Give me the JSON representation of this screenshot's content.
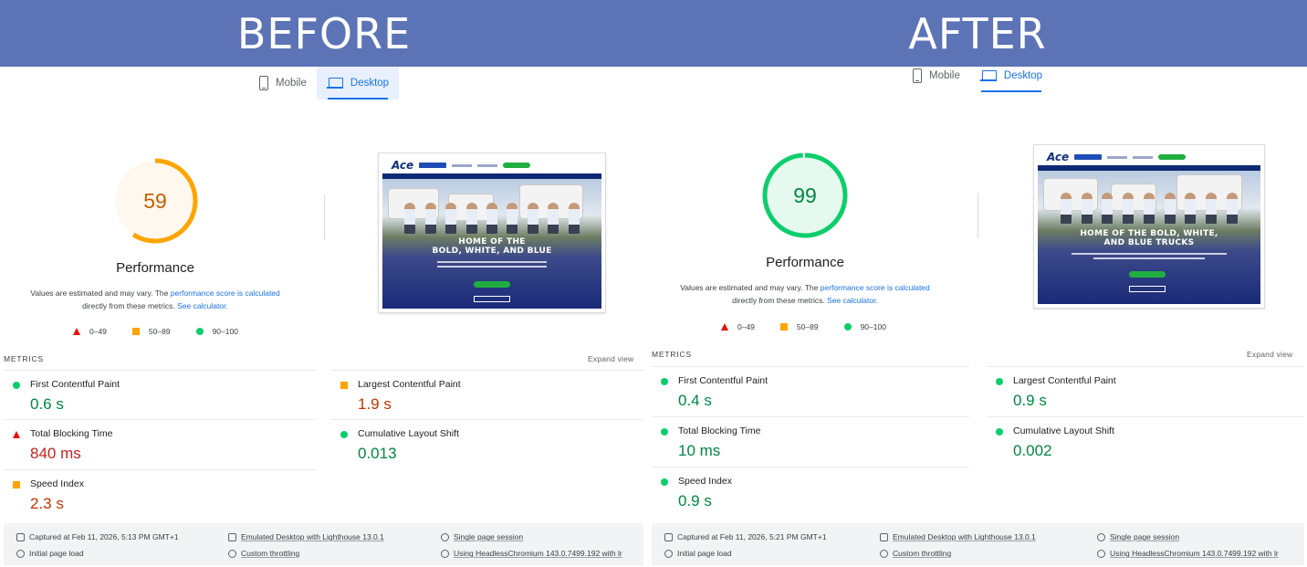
{
  "banners": {
    "before": "BEFORE",
    "after": "AFTER"
  },
  "tabs": {
    "mobile": "Mobile",
    "desktop": "Desktop"
  },
  "icons": {
    "mobile": "phone-icon",
    "desktop": "laptop-icon"
  },
  "colors": {
    "banner": "#5c74b5",
    "link": "#1a73e8",
    "pass": "#0cce6b",
    "average": "#ffa400",
    "fail": "#eb0f00"
  },
  "before": {
    "score": "59",
    "score_value": 59,
    "category": "Performance",
    "note_prefix": "Values are estimated and may vary. The ",
    "note_link1": "performance score is calculated",
    "note_mid": "directly from these metrics. ",
    "note_link2": "See calculator.",
    "legend": [
      "0–49",
      "50–89",
      "90–100"
    ],
    "site": {
      "logo": "Ace",
      "hero_line1": "HOME OF THE",
      "hero_line2": "BOLD, WHITE, AND BLUE"
    },
    "metrics_title": "METRICS",
    "expand": "Expand view",
    "metrics": [
      {
        "name": "First Contentful Paint",
        "value": "0.6 s",
        "status": "pass"
      },
      {
        "name": "Largest Contentful Paint",
        "value": "1.9 s",
        "status": "average"
      },
      {
        "name": "Total Blocking Time",
        "value": "840 ms",
        "status": "fail"
      },
      {
        "name": "Cumulative Layout Shift",
        "value": "0.013",
        "status": "pass"
      },
      {
        "name": "Speed Index",
        "value": "2.3 s",
        "status": "average"
      }
    ],
    "footer": {
      "captured": "Captured at Feb 11, 2026, 5:13 PM GMT+1",
      "initial": "Initial page load",
      "emulated": "Emulated Desktop with Lighthouse 13.0.1",
      "throttling": "Custom throttling",
      "session": "Single page session",
      "browser": "Using HeadlessChromium 143.0.7499.192 with lr"
    }
  },
  "after": {
    "score": "99",
    "score_value": 99,
    "category": "Performance",
    "note_prefix": "Values are estimated and may vary. The ",
    "note_link1": "performance score is calculated",
    "note_mid": "directly from these metrics. ",
    "note_link2": "See calculator.",
    "legend": [
      "0–49",
      "50–89",
      "90–100"
    ],
    "site": {
      "logo": "Ace",
      "hero_line1": "HOME OF THE BOLD, WHITE,",
      "hero_line2": "AND BLUE TRUCKS"
    },
    "metrics_title": "METRICS",
    "expand": "Expand view",
    "metrics": [
      {
        "name": "First Contentful Paint",
        "value": "0.4 s",
        "status": "pass"
      },
      {
        "name": "Largest Contentful Paint",
        "value": "0.9 s",
        "status": "pass"
      },
      {
        "name": "Total Blocking Time",
        "value": "10 ms",
        "status": "pass"
      },
      {
        "name": "Cumulative Layout Shift",
        "value": "0.002",
        "status": "pass"
      },
      {
        "name": "Speed Index",
        "value": "0.9 s",
        "status": "pass"
      }
    ],
    "footer": {
      "captured": "Captured at Feb 11, 2026, 5:21 PM GMT+1",
      "initial": "Initial page load",
      "emulated": "Emulated Desktop with Lighthouse 13.0.1",
      "throttling": "Custom throttling",
      "session": "Single page session",
      "browser": "Using HeadlessChromium 143.0.7499.192 with lr"
    }
  }
}
